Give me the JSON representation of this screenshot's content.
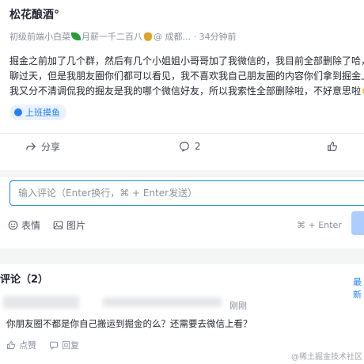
{
  "post": {
    "author": "松花酿酒°",
    "meta_prefix": "初级前端小白菜",
    "meta_mid": "月薪一千二百八",
    "meta_suffix": "@ 成都... · 34分钟前",
    "content_lines": [
      "掘金之前加了几个群，然后有几个小姐姐小哥哥加了我微信的，我目前全部删除了哈，",
      "聊过天，但是我朋友圈你们都可以看见，我不喜欢我自己朋友圈的内容你们拿到掘金上",
      "我又分不清调侃我的掘友是我的哪个微信好友，所以我索性全部删除啦，不好意思啦"
    ],
    "tag": "上班摸鱼",
    "actions": {
      "share": "分享",
      "comments": "2"
    }
  },
  "comment_box": {
    "placeholder": "输入评论（Enter换行，⌘ + Enter发送）",
    "emoji_label": "表情",
    "image_label": "图片",
    "shortcut": "⌘ + Enter"
  },
  "comments": {
    "title": "评论（2）",
    "sort_label": "最新",
    "items": [
      {
        "time": "刚刚",
        "text": "你朋友圈不都是你自己搬运到掘金的么？还需要去微信上看？",
        "like_label": "点赞",
        "reply_label": "回复"
      }
    ]
  },
  "watermark": "@稀土掘金技术社区",
  "colors": {
    "accent": "#1e80ff",
    "tag_bg": "#eaf2ff",
    "send_disabled": "#abcdff"
  }
}
